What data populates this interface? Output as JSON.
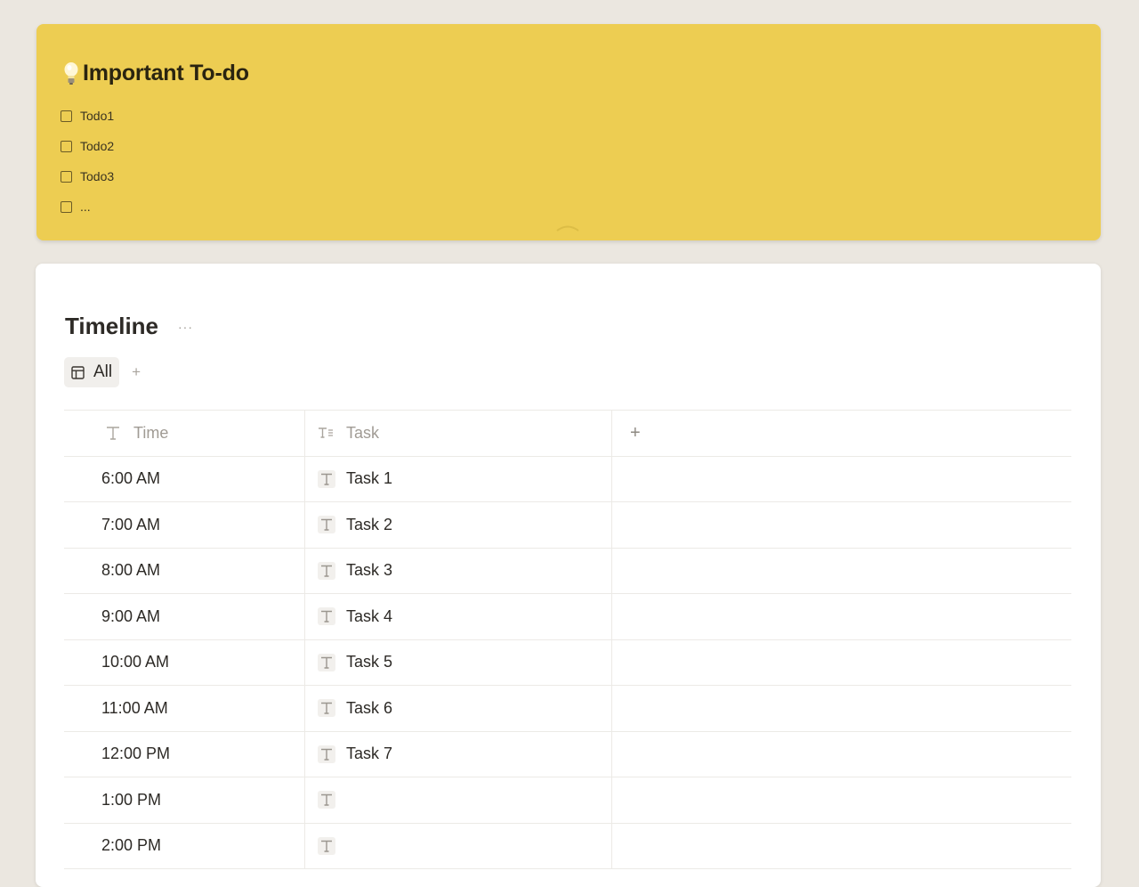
{
  "todo": {
    "title": "Important To-do",
    "items": [
      {
        "label": "Todo1",
        "checked": false
      },
      {
        "label": "Todo2",
        "checked": false
      },
      {
        "label": "Todo3",
        "checked": false
      },
      {
        "label": "...",
        "checked": false
      }
    ],
    "icon": "lightbulb-icon",
    "background": "#edcd52"
  },
  "timeline": {
    "title": "Timeline",
    "more_icon": "···",
    "views": [
      {
        "label": "All",
        "icon": "table-icon"
      }
    ],
    "add_view": "+",
    "columns": [
      {
        "label": "Time",
        "icon": "text-type-icon"
      },
      {
        "label": "Task",
        "icon": "text-list-type-icon"
      }
    ],
    "add_column": "+",
    "rows": [
      {
        "time": "6:00  AM",
        "task": "Task 1"
      },
      {
        "time": "7:00 AM",
        "task": "Task 2"
      },
      {
        "time": "8:00 AM",
        "task": "Task 3"
      },
      {
        "time": "9:00 AM",
        "task": "Task 4"
      },
      {
        "time": "10:00 AM",
        "task": "Task 5"
      },
      {
        "time": "11:00 AM",
        "task": "Task 6"
      },
      {
        "time": "12:00 PM",
        "task": "Task 7"
      },
      {
        "time": "1:00 PM",
        "task": ""
      },
      {
        "time": "2:00 PM",
        "task": ""
      }
    ]
  }
}
